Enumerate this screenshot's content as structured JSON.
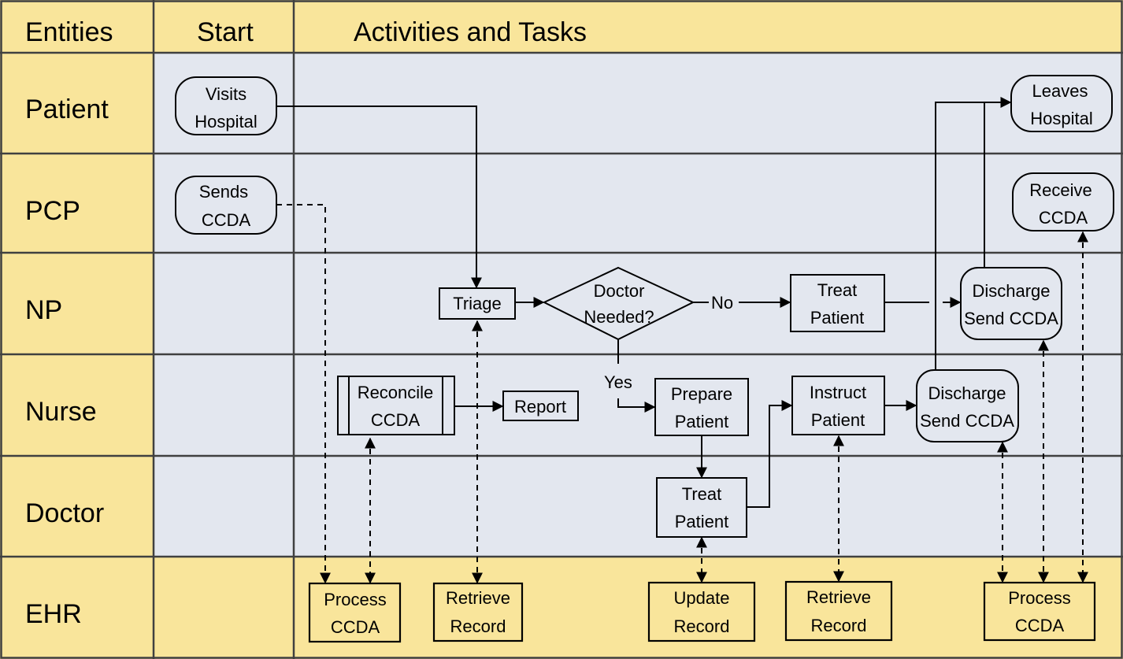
{
  "header": {
    "entities": "Entities",
    "start": "Start",
    "activities": "Activities and Tasks"
  },
  "lanes": [
    "Patient",
    "PCP",
    "NP",
    "Nurse",
    "Doctor",
    "EHR"
  ],
  "colors": {
    "header_lane": "#f9e59b",
    "body_lane": "#e3e7ef",
    "grid": "#404040"
  },
  "nodes": {
    "visits_hospital": [
      "Visits",
      "Hospital"
    ],
    "sends_ccda": [
      "Sends",
      "CCDA"
    ],
    "leaves_hospital": [
      "Leaves",
      "Hospital"
    ],
    "receive_ccda": [
      "Receive",
      "CCDA"
    ],
    "triage": [
      "Triage"
    ],
    "doctor_needed": [
      "Doctor",
      "Needed?"
    ],
    "np_treat_patient": [
      "Treat",
      "Patient"
    ],
    "np_discharge": [
      "Discharge",
      "Send CCDA"
    ],
    "reconcile_ccda": [
      "Reconcile",
      "CCDA"
    ],
    "report": [
      "Report"
    ],
    "prepare_patient": [
      "Prepare",
      "Patient"
    ],
    "instruct_patient": [
      "Instruct",
      "Patient"
    ],
    "nurse_discharge": [
      "Discharge",
      "Send CCDA"
    ],
    "doctor_treat_patient": [
      "Treat",
      "Patient"
    ],
    "ehr_process_ccda_1": [
      "Process",
      "CCDA"
    ],
    "ehr_retrieve_record_1": [
      "Retrieve",
      "Record"
    ],
    "ehr_update_record": [
      "Update",
      "Record"
    ],
    "ehr_retrieve_record_2": [
      "Retrieve",
      "Record"
    ],
    "ehr_process_ccda_2": [
      "Process",
      "CCDA"
    ]
  },
  "edge_labels": {
    "no": "No",
    "yes": "Yes"
  }
}
